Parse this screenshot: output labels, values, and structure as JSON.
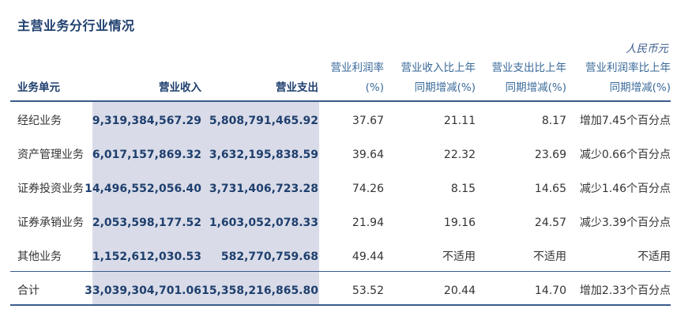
{
  "title": "主营业务分行业情况",
  "unit": "人民币元",
  "headers": {
    "segment": "业务单元",
    "revenue": "营业收入",
    "expense": "营业支出",
    "margin_l1": "营业利润率",
    "margin_l2": "(%)",
    "rev_chg_l1": "营业收入比上年",
    "rev_chg_l2": "同期增减(%)",
    "exp_chg_l1": "营业支出比上年",
    "exp_chg_l2": "同期增减(%)",
    "margin_chg_l1": "营业利润率比上年",
    "margin_chg_l2": "同期增减(%)"
  },
  "rows": [
    {
      "segment": "经纪业务",
      "revenue": "9,319,384,567.29",
      "expense": "5,808,791,465.92",
      "margin": "37.67",
      "rev_chg": "21.11",
      "exp_chg": "8.17",
      "margin_chg": "增加7.45个百分点"
    },
    {
      "segment": "资产管理业务",
      "revenue": "6,017,157,869.32",
      "expense": "3,632,195,838.59",
      "margin": "39.64",
      "rev_chg": "22.32",
      "exp_chg": "23.69",
      "margin_chg": "减少0.66个百分点"
    },
    {
      "segment": "证券投资业务",
      "revenue": "14,496,552,056.40",
      "expense": "3,731,406,723.28",
      "margin": "74.26",
      "rev_chg": "8.15",
      "exp_chg": "14.65",
      "margin_chg": "减少1.46个百分点"
    },
    {
      "segment": "证券承销业务",
      "revenue": "2,053,598,177.52",
      "expense": "1,603,052,078.33",
      "margin": "21.94",
      "rev_chg": "19.16",
      "exp_chg": "24.57",
      "margin_chg": "减少3.39个百分点"
    },
    {
      "segment": "其他业务",
      "revenue": "1,152,612,030.53",
      "expense": "582,770,759.68",
      "margin": "49.44",
      "rev_chg": "不适用",
      "exp_chg": "不适用",
      "margin_chg": "不适用"
    }
  ],
  "total": {
    "segment": "合计",
    "revenue": "33,039,304,701.06",
    "expense": "15,358,216,865.80",
    "margin": "53.52",
    "rev_chg": "20.44",
    "exp_chg": "14.70",
    "margin_chg": "增加2.33个百分点"
  }
}
